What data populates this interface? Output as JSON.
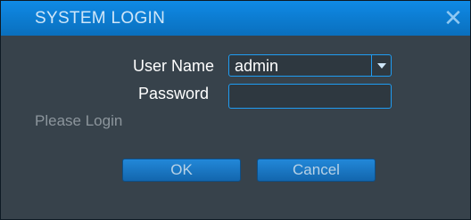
{
  "dialog": {
    "title": "SYSTEM LOGIN",
    "close_icon": "close-icon"
  },
  "form": {
    "username_label": "User Name",
    "username_value": "admin",
    "password_label": "Password",
    "password_value": ""
  },
  "status": {
    "message": "Please Login"
  },
  "buttons": {
    "ok_label": "OK",
    "cancel_label": "Cancel"
  },
  "colors": {
    "titlebar": "#0f8ae6",
    "panel": "#37424b",
    "accent": "#1f9cf2"
  }
}
